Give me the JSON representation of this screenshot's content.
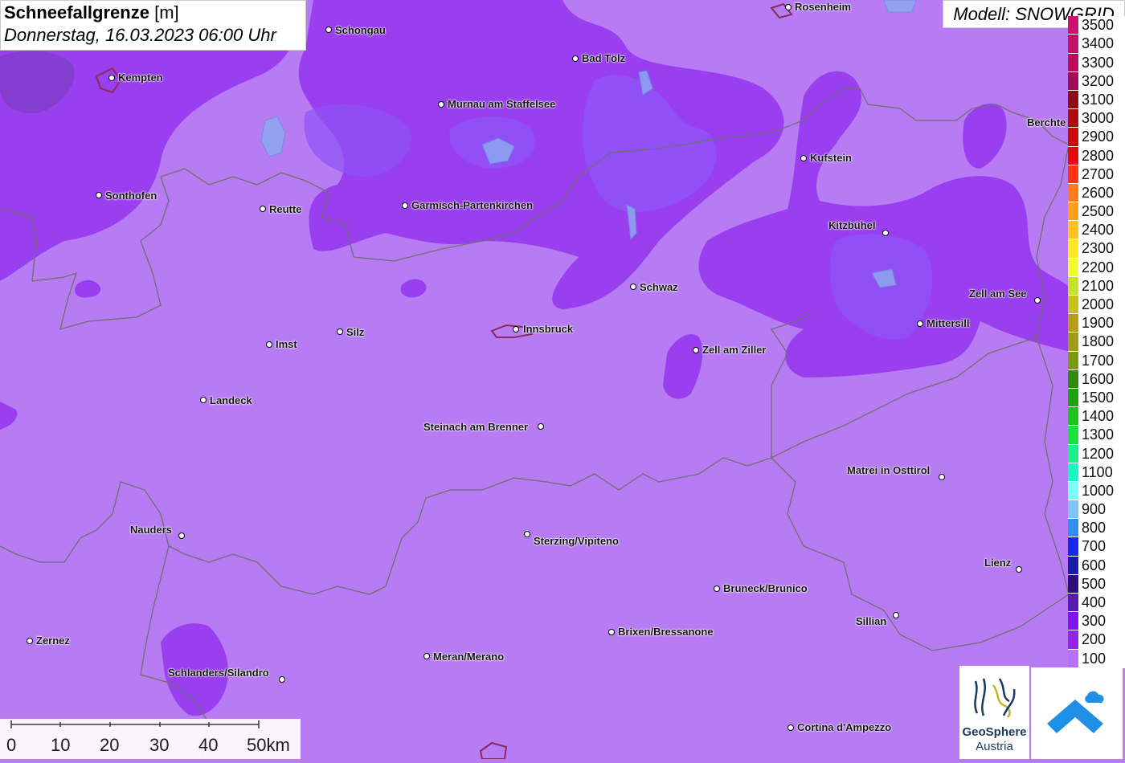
{
  "title": {
    "main": "Schneefallgrenze",
    "unit": "[m]",
    "date": "Donnerstag, 16.03.2023 06:00 Uhr"
  },
  "model": "Modell: SNOWGRID",
  "legend": {
    "levels": [
      {
        "label": "3500",
        "color": "#cc1070"
      },
      {
        "label": "3400",
        "color": "#c40f66"
      },
      {
        "label": "3300",
        "color": "#b80d5e"
      },
      {
        "label": "3200",
        "color": "#a00d58"
      },
      {
        "label": "3100",
        "color": "#8c0d13"
      },
      {
        "label": "3000",
        "color": "#b00b0b"
      },
      {
        "label": "2900",
        "color": "#cf0909"
      },
      {
        "label": "2800",
        "color": "#e80a0a"
      },
      {
        "label": "2700",
        "color": "#ff3311"
      },
      {
        "label": "2600",
        "color": "#ff7d18"
      },
      {
        "label": "2500",
        "color": "#ff9e1c"
      },
      {
        "label": "2400",
        "color": "#ffc21e"
      },
      {
        "label": "2300",
        "color": "#ffe726"
      },
      {
        "label": "2200",
        "color": "#f0ff2a"
      },
      {
        "label": "2100",
        "color": "#c8e22a"
      },
      {
        "label": "2000",
        "color": "#c6c21a"
      },
      {
        "label": "1900",
        "color": "#b99c16"
      },
      {
        "label": "1800",
        "color": "#9e9b14"
      },
      {
        "label": "1700",
        "color": "#7e9a12"
      },
      {
        "label": "1600",
        "color": "#2f8a0f"
      },
      {
        "label": "1500",
        "color": "#1aa30f"
      },
      {
        "label": "1400",
        "color": "#1bc41a"
      },
      {
        "label": "1300",
        "color": "#19e23a"
      },
      {
        "label": "1200",
        "color": "#19f08a"
      },
      {
        "label": "1100",
        "color": "#19f7c0"
      },
      {
        "label": "1000",
        "color": "#7dfbfb"
      },
      {
        "label": "900",
        "color": "#7cc4f3"
      },
      {
        "label": "800",
        "color": "#2f8ef0"
      },
      {
        "label": "700",
        "color": "#1428f0"
      },
      {
        "label": "600",
        "color": "#1a1aa8"
      },
      {
        "label": "500",
        "color": "#2a0f7c"
      },
      {
        "label": "400",
        "color": "#5a1ab0"
      },
      {
        "label": "300",
        "color": "#7e15f0"
      },
      {
        "label": "200",
        "color": "#9224e6"
      },
      {
        "label": "100",
        "color": "#bb6ef8"
      }
    ]
  },
  "cities": [
    {
      "name": "Rosenheim"
    },
    {
      "name": "Schongau"
    },
    {
      "name": "Bad Tölz"
    },
    {
      "name": "Kempten"
    },
    {
      "name": "Murnau am Staffelsee"
    },
    {
      "name": "Berchte"
    },
    {
      "name": "Kufstein"
    },
    {
      "name": "Sonthofen"
    },
    {
      "name": "Reutte"
    },
    {
      "name": "Garmisch-Partenkirchen"
    },
    {
      "name": "Kitzbühel"
    },
    {
      "name": "Schwaz"
    },
    {
      "name": "Zell am See"
    },
    {
      "name": "Mittersill"
    },
    {
      "name": "Silz"
    },
    {
      "name": "Innsbruck"
    },
    {
      "name": "Imst"
    },
    {
      "name": "Zell am Ziller"
    },
    {
      "name": "Landeck"
    },
    {
      "name": "Steinach am Brenner"
    },
    {
      "name": "Matrei in Osttirol"
    },
    {
      "name": "Nauders"
    },
    {
      "name": "Sterzing/Vipiteno"
    },
    {
      "name": "Lienz"
    },
    {
      "name": "Bruneck/Brunico"
    },
    {
      "name": "Sillian"
    },
    {
      "name": "Brixen/Bressanone"
    },
    {
      "name": "Zernez"
    },
    {
      "name": "Meran/Merano"
    },
    {
      "name": "Schlanders/Silandro"
    },
    {
      "name": "Cortina d'Ampezzo"
    }
  ],
  "scale": {
    "ticks": [
      "0",
      "10",
      "20",
      "30",
      "40",
      "50km"
    ]
  },
  "logos": {
    "geosphere_name": "GeoSphere",
    "geosphere_sub": "Austria"
  },
  "colors": {
    "base": "#b77cf3",
    "mid": "#a24ff0",
    "dark": "#8a3ff0",
    "blue": "#8f52f5"
  }
}
